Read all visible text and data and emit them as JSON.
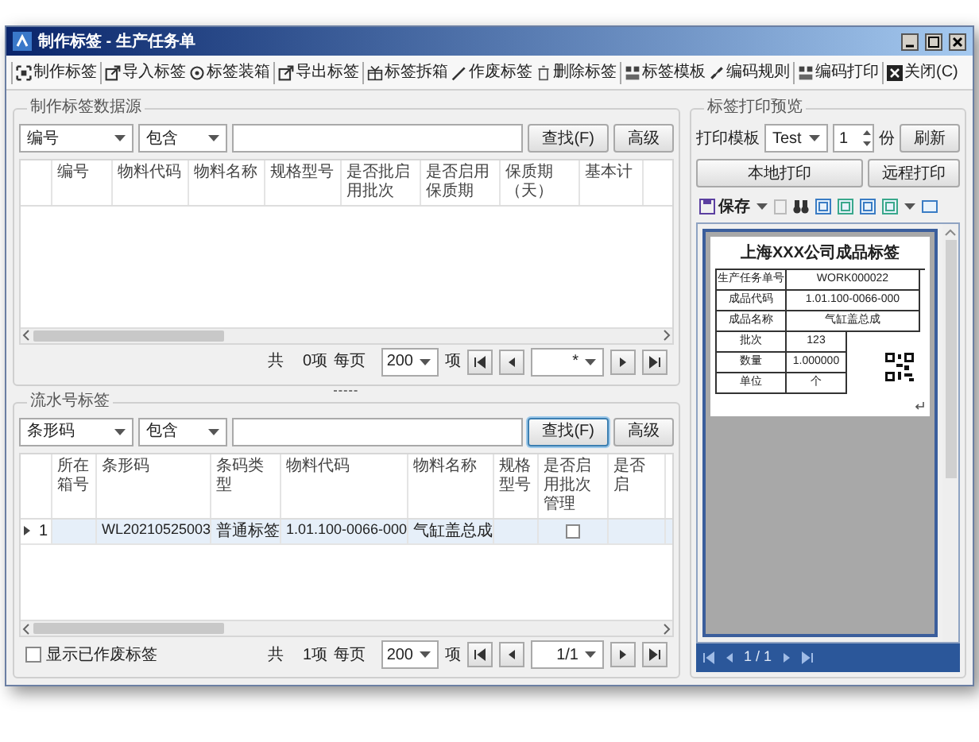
{
  "window": {
    "title": "制作标签 - 生产任务单"
  },
  "toolbar": [
    [
      {
        "label": "制作标签"
      }
    ],
    [
      {
        "label": "导入标签"
      },
      {
        "label": "标签装箱"
      }
    ],
    [
      {
        "label": "导出标签"
      }
    ],
    [
      {
        "label": "标签拆箱"
      },
      {
        "label": "作废标签"
      },
      {
        "label": "删除标签"
      }
    ],
    [
      {
        "label": "标签模板"
      },
      {
        "label": "编码规则"
      }
    ],
    [
      {
        "label": "编码打印"
      }
    ],
    [
      {
        "label": "关闭(C)"
      }
    ]
  ],
  "data_source": {
    "legend": "制作标签数据源",
    "field": "编号",
    "operator": "包含",
    "find_button": "查找(F)",
    "advanced_button": "高级",
    "columns": [
      "编号",
      "物料代码",
      "物料名称",
      "规格型号",
      "是否批启用批次",
      "是否启用保质期",
      "保质期（天）",
      "基本计"
    ],
    "pager": {
      "total": "共",
      "count": "0项",
      "per_page": "每页",
      "page_size": "200",
      "unit": "项",
      "page": "*"
    }
  },
  "serial_labels": {
    "legend": "流水号标签",
    "field": "条形码",
    "operator": "包含",
    "find_button": "查找(F)",
    "advanced_button": "高级",
    "columns": [
      "所在箱号",
      "条形码",
      "条码类型",
      "物料代码",
      "物料名称",
      "规格型号",
      "是否启用批次管理",
      "是否启"
    ],
    "rows": [
      {
        "index": "1",
        "selected": true,
        "cells": [
          {
            "kind": "empty"
          },
          {
            "kind": "text",
            "text": "WL20210525003"
          },
          {
            "kind": "text",
            "text": "普通标签"
          },
          {
            "kind": "text",
            "text": "1.01.100-0066-000"
          },
          {
            "kind": "text",
            "text": "气缸盖总成"
          },
          {
            "kind": "empty"
          },
          {
            "kind": "checkbox",
            "checked": false
          },
          {
            "kind": "empty"
          }
        ]
      }
    ],
    "show_voided": {
      "label": "显示已作废标签",
      "checked": false
    },
    "pager": {
      "total": "共",
      "count": "1项",
      "per_page": "每页",
      "page_size": "200",
      "unit": "项",
      "page": "1/1"
    }
  },
  "preview": {
    "legend": "标签打印预览",
    "template_label": "打印模板",
    "template": "Test",
    "copies": "1",
    "copies_unit": "份",
    "refresh_button": "刷新",
    "local_print_button": "本地打印",
    "remote_print_button": "远程打印",
    "save_button": "保存",
    "label": {
      "title": "上海XXX公司成品标签",
      "rows": [
        {
          "kind": "wide",
          "name": "生产任务单号",
          "value": "WORK000022"
        },
        {
          "kind": "wide",
          "name": "成品代码",
          "value": "1.01.100-0066-000"
        },
        {
          "kind": "wide",
          "name": "成品名称",
          "value": "气缸盖总成"
        },
        {
          "kind": "narrow",
          "name": "批次",
          "value": "123"
        },
        {
          "kind": "narrow",
          "name": "数量",
          "value": "1.000000"
        },
        {
          "kind": "narrow",
          "name": "单位",
          "value": "个"
        }
      ]
    },
    "nav": {
      "page": "1 / 1"
    }
  }
}
